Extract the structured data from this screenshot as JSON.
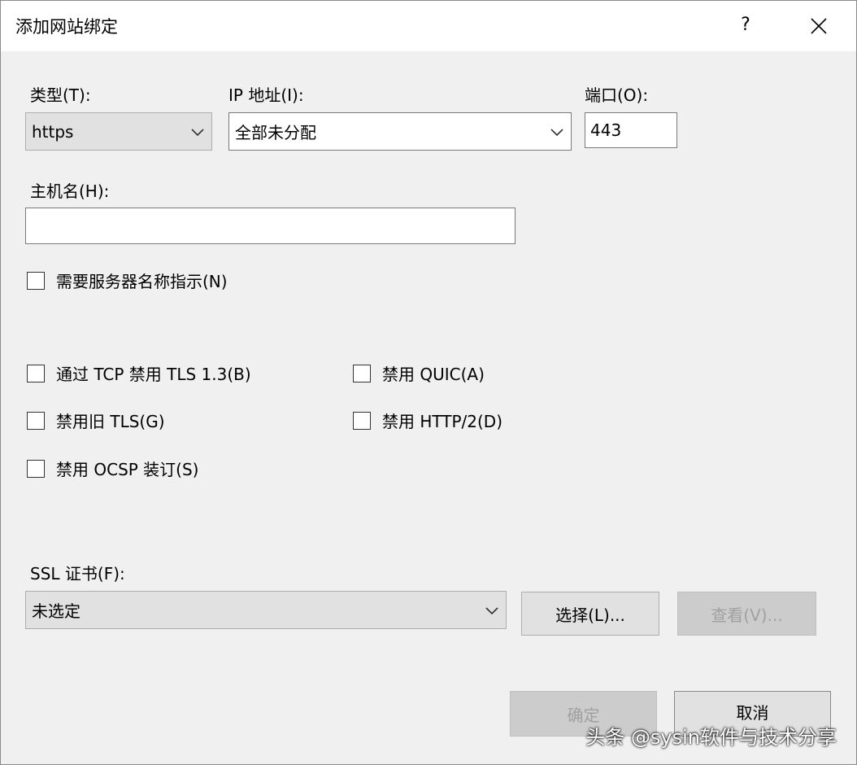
{
  "window": {
    "title": "添加网站绑定",
    "help_label": "?",
    "close_label": "close"
  },
  "binding": {
    "type_label": "类型(T):",
    "type_value": "https",
    "ip_label": "IP 地址(I):",
    "ip_value": "全部未分配",
    "port_label": "端口(O):",
    "port_value": "443",
    "hostname_label": "主机名(H):",
    "hostname_value": "",
    "sni_label": "需要服务器名称指示(N)"
  },
  "options": {
    "disable_tls13_tcp": "通过 TCP 禁用 TLS 1.3(B)",
    "disable_quic": "禁用 QUIC(A)",
    "disable_legacy_tls": "禁用旧 TLS(G)",
    "disable_http2": "禁用 HTTP/2(D)",
    "disable_ocsp": "禁用 OCSP 装订(S)"
  },
  "ssl": {
    "label": "SSL 证书(F):",
    "value": "未选定",
    "select_button": "选择(L)...",
    "view_button": "查看(V)..."
  },
  "footer": {
    "ok_button": "确定",
    "cancel_button": "取消"
  },
  "watermark": "头条 @sysin软件与技术分享"
}
